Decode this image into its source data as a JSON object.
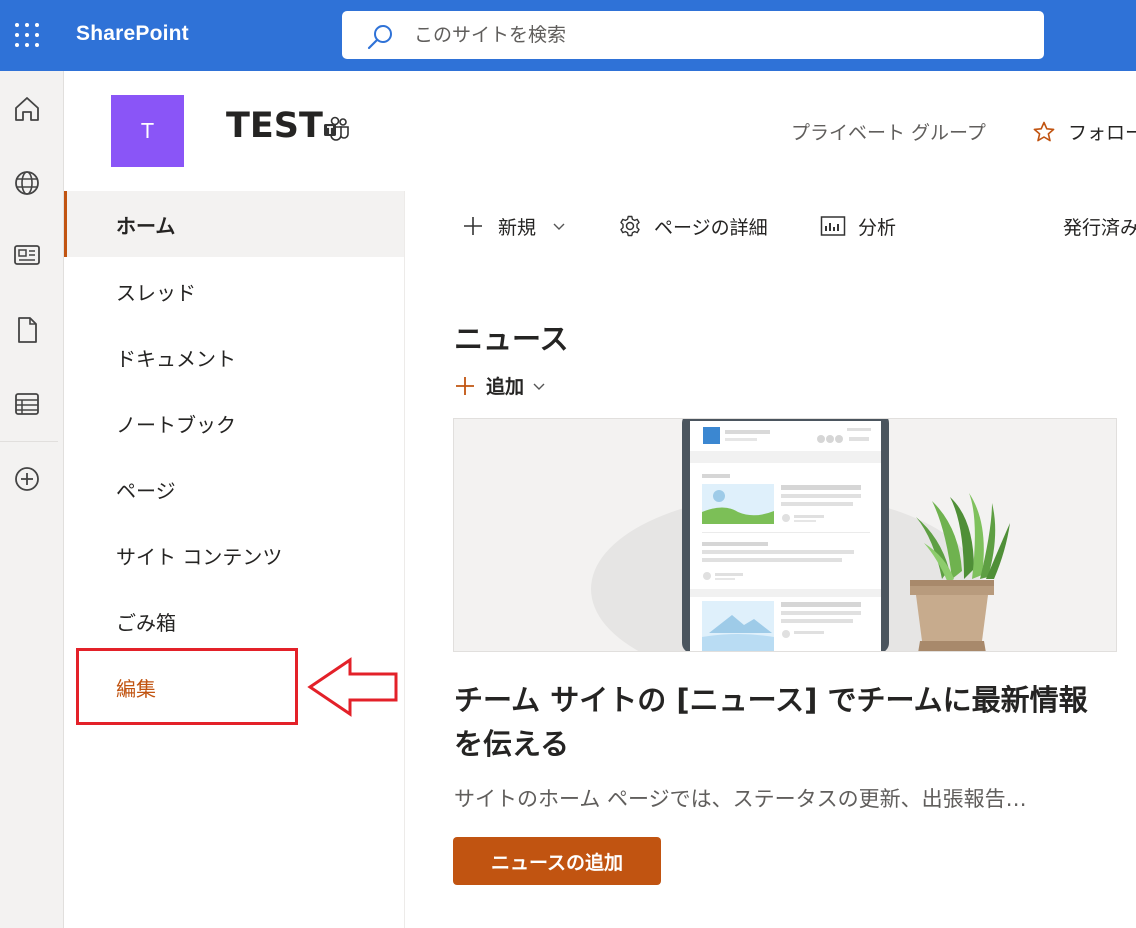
{
  "suite": {
    "brand": "SharePoint",
    "search_placeholder": "このサイトを検索"
  },
  "appbar": {
    "items": [
      "home-icon",
      "globe-icon",
      "news-icon",
      "document-icon",
      "list-icon",
      "add-circle-icon"
    ]
  },
  "site": {
    "logo_letter": "T",
    "title": "TEST",
    "privacy": "プライベート グループ",
    "follow_label": "フォロー"
  },
  "leftnav": {
    "items": [
      {
        "label": "ホーム",
        "selected": true
      },
      {
        "label": "スレッド"
      },
      {
        "label": "ドキュメント"
      },
      {
        "label": "ノートブック"
      },
      {
        "label": "ページ"
      },
      {
        "label": "サイト コンテンツ"
      },
      {
        "label": "ごみ箱"
      },
      {
        "label": "編集"
      }
    ]
  },
  "commandbar": {
    "new_label": "新規",
    "page_details_label": "ページの詳細",
    "analytics_label": "分析",
    "published_label": "発行済み"
  },
  "news": {
    "title": "ニュース",
    "add_label": "追加",
    "headline": "チーム サイトの [ニュース] でチームに最新情報を伝える",
    "description": "サイトのホーム ページでは、ステータスの更新、出張報告…",
    "add_news_button": "ニュースの追加"
  },
  "colors": {
    "suite_bar": "#2f72d7",
    "accent": "#c15411",
    "site_logo": "#8a55f7",
    "annotation": "#e32129"
  }
}
